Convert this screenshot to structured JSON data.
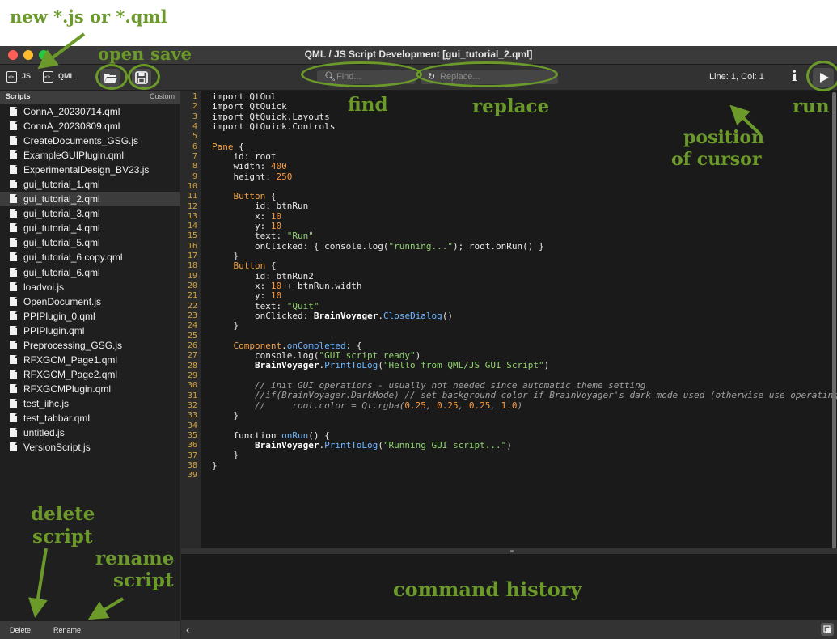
{
  "window": {
    "title": "QML / JS Script Development  [gui_tutorial_2.qml]",
    "colors": {
      "close": "#ff5f57",
      "minimize": "#febc2e",
      "zoom": "#28c840",
      "annotation": "#6b9a2a",
      "number": "#ff9a3c",
      "string": "#8fd16e",
      "function": "#6fb6ff"
    }
  },
  "toolbar": {
    "new_js_label": "JS",
    "new_qml_label": "QML",
    "open_icon": "folder-open-icon",
    "save_icon": "floppy-disk-icon",
    "find_placeholder": "Find...",
    "replace_placeholder": "Replace...",
    "cursor_position": "Line: 1, Col: 1",
    "info_label": "i",
    "run_icon": "play-icon"
  },
  "sidebar": {
    "tab_scripts": "Scripts",
    "tab_custom": "Custom",
    "files": [
      "ConnA_20230714.qml",
      "ConnA_20230809.qml",
      "CreateDocuments_GSG.js",
      "ExampleGUIPlugin.qml",
      "ExperimentalDesign_BV23.js",
      "gui_tutorial_1.qml",
      "gui_tutorial_2.qml",
      "gui_tutorial_3.qml",
      "gui_tutorial_4.qml",
      "gui_tutorial_5.qml",
      "gui_tutorial_6 copy.qml",
      "gui_tutorial_6.qml",
      "loadvoi.js",
      "OpenDocument.js",
      "PPIPlugin_0.qml",
      "PPIPlugin.qml",
      "Preprocessing_GSG.js",
      "RFXGCM_Page1.qml",
      "RFXGCM_Page2.qml",
      "RFXGCMPlugin.qml",
      "test_iihc.js",
      "test_tabbar.qml",
      "untitled.js",
      "VersionScript.js"
    ],
    "selected_file": "gui_tutorial_2.qml",
    "delete_label": "Delete",
    "rename_label": "Rename"
  },
  "editor": {
    "line_count": 39,
    "lines": [
      [
        [
          "kw",
          "import "
        ],
        [
          "pl",
          "QtQml"
        ]
      ],
      [
        [
          "kw",
          "import "
        ],
        [
          "pl",
          "QtQuick"
        ]
      ],
      [
        [
          "kw",
          "import "
        ],
        [
          "pl",
          "QtQuick.Layouts"
        ]
      ],
      [
        [
          "kw",
          "import "
        ],
        [
          "pl",
          "QtQuick.Controls"
        ]
      ],
      [],
      [
        [
          "ty",
          "Pane"
        ],
        [
          "pl",
          " {"
        ]
      ],
      [
        [
          "pl",
          "    id: root"
        ]
      ],
      [
        [
          "pl",
          "    width: "
        ],
        [
          "num",
          "400"
        ]
      ],
      [
        [
          "pl",
          "    height: "
        ],
        [
          "num",
          "250"
        ]
      ],
      [],
      [
        [
          "ty",
          "    Button"
        ],
        [
          "pl",
          " {"
        ]
      ],
      [
        [
          "pl",
          "        id: btnRun"
        ]
      ],
      [
        [
          "pl",
          "        x: "
        ],
        [
          "num",
          "10"
        ]
      ],
      [
        [
          "pl",
          "        y: "
        ],
        [
          "num",
          "10"
        ]
      ],
      [
        [
          "pl",
          "        text: "
        ],
        [
          "str",
          "\"Run\""
        ]
      ],
      [
        [
          "pl",
          "        onClicked: { console.log("
        ],
        [
          "str",
          "\"running...\""
        ],
        [
          "pl",
          "); root.onRun() }"
        ]
      ],
      [
        [
          "pl",
          "    }"
        ]
      ],
      [
        [
          "ty",
          "    Button"
        ],
        [
          "pl",
          " {"
        ]
      ],
      [
        [
          "pl",
          "        id: btnRun2"
        ]
      ],
      [
        [
          "pl",
          "        x: "
        ],
        [
          "num",
          "10"
        ],
        [
          "pl",
          " + btnRun.width"
        ]
      ],
      [
        [
          "pl",
          "        y: "
        ],
        [
          "num",
          "10"
        ]
      ],
      [
        [
          "pl",
          "        text: "
        ],
        [
          "str",
          "\"Quit\""
        ]
      ],
      [
        [
          "pl",
          "        onClicked: "
        ],
        [
          "bld",
          "BrainVoyager"
        ],
        [
          "pl",
          "."
        ],
        [
          "fn",
          "CloseDialog"
        ],
        [
          "pl",
          "()"
        ]
      ],
      [
        [
          "pl",
          "    }"
        ]
      ],
      [],
      [
        [
          "ty",
          "    Component"
        ],
        [
          "pl",
          "."
        ],
        [
          "fn",
          "onCompleted"
        ],
        [
          "pl",
          ": {"
        ]
      ],
      [
        [
          "pl",
          "        console.log("
        ],
        [
          "str",
          "\"GUI script ready\""
        ],
        [
          "pl",
          ")"
        ]
      ],
      [
        [
          "bld",
          "        BrainVoyager"
        ],
        [
          "pl",
          "."
        ],
        [
          "fn",
          "PrintToLog"
        ],
        [
          "pl",
          "("
        ],
        [
          "str",
          "\"Hello from QML/JS GUI Script\""
        ],
        [
          "pl",
          ")"
        ]
      ],
      [],
      [
        [
          "cmt",
          "        // init GUI operations - usually not needed since automatic theme setting"
        ]
      ],
      [
        [
          "cmt",
          "        //if(BrainVoyager.DarkMode) // set background color if BrainVoyager's dark mode used (otherwise use operating"
        ]
      ],
      [
        [
          "cmt",
          "        //     root.color = Qt.rgba("
        ],
        [
          "num",
          "0.25"
        ],
        [
          "cmt",
          ", "
        ],
        [
          "num",
          "0.25"
        ],
        [
          "cmt",
          ", "
        ],
        [
          "num",
          "0.25"
        ],
        [
          "cmt",
          ", "
        ],
        [
          "num",
          "1.0"
        ],
        [
          "cmt",
          ")"
        ]
      ],
      [
        [
          "pl",
          "    }"
        ]
      ],
      [],
      [
        [
          "kw",
          "    function "
        ],
        [
          "fn",
          "onRun"
        ],
        [
          "pl",
          "() {"
        ]
      ],
      [
        [
          "bld",
          "        BrainVoyager"
        ],
        [
          "pl",
          "."
        ],
        [
          "fn",
          "PrintToLog"
        ],
        [
          "pl",
          "("
        ],
        [
          "str",
          "\"Running GUI script...\""
        ],
        [
          "pl",
          ")"
        ]
      ],
      [
        [
          "pl",
          "    }"
        ]
      ],
      [
        [
          "pl",
          "}"
        ]
      ],
      []
    ]
  },
  "statusbar": {
    "collapse_icon": "chevron-left-icon",
    "corner_icon": "window-icon"
  },
  "annotations": {
    "new": "new *.js or *.qml",
    "open": "open",
    "save": "save",
    "find": "find",
    "replace": "replace",
    "position": "position",
    "of_cursor": "of cursor",
    "run": "run",
    "delete1": "delete",
    "delete2": "script",
    "rename1": "rename",
    "rename2": "script",
    "history": "command history"
  }
}
